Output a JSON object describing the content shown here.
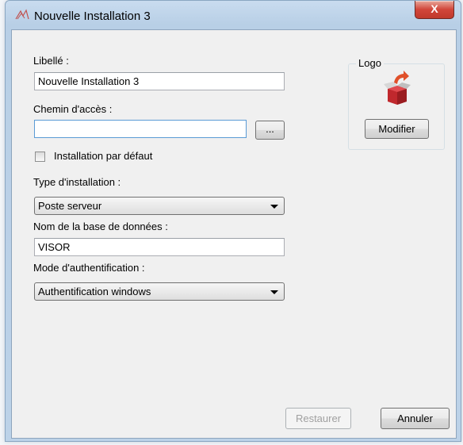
{
  "window": {
    "title": "Nouvelle Installation 3",
    "close_label": "X"
  },
  "form": {
    "libelle_label": "Libellé :",
    "libelle_value": "Nouvelle Installation 3",
    "chemin_label": "Chemin d'accès :",
    "chemin_value": "",
    "browse_label": "...",
    "default_checkbox_label": "Installation par défaut",
    "default_checked": false,
    "type_label": "Type d'installation :",
    "type_value": "Poste serveur",
    "db_label": "Nom de la base de données :",
    "db_value": "VISOR",
    "auth_label": "Mode d'authentification :",
    "auth_value": "Authentification windows"
  },
  "logo": {
    "caption": "Logo",
    "icon": "open-box-arrow-icon",
    "modify_label": "Modifier"
  },
  "footer": {
    "restore_label": "Restaurer",
    "cancel_label": "Annuler"
  }
}
